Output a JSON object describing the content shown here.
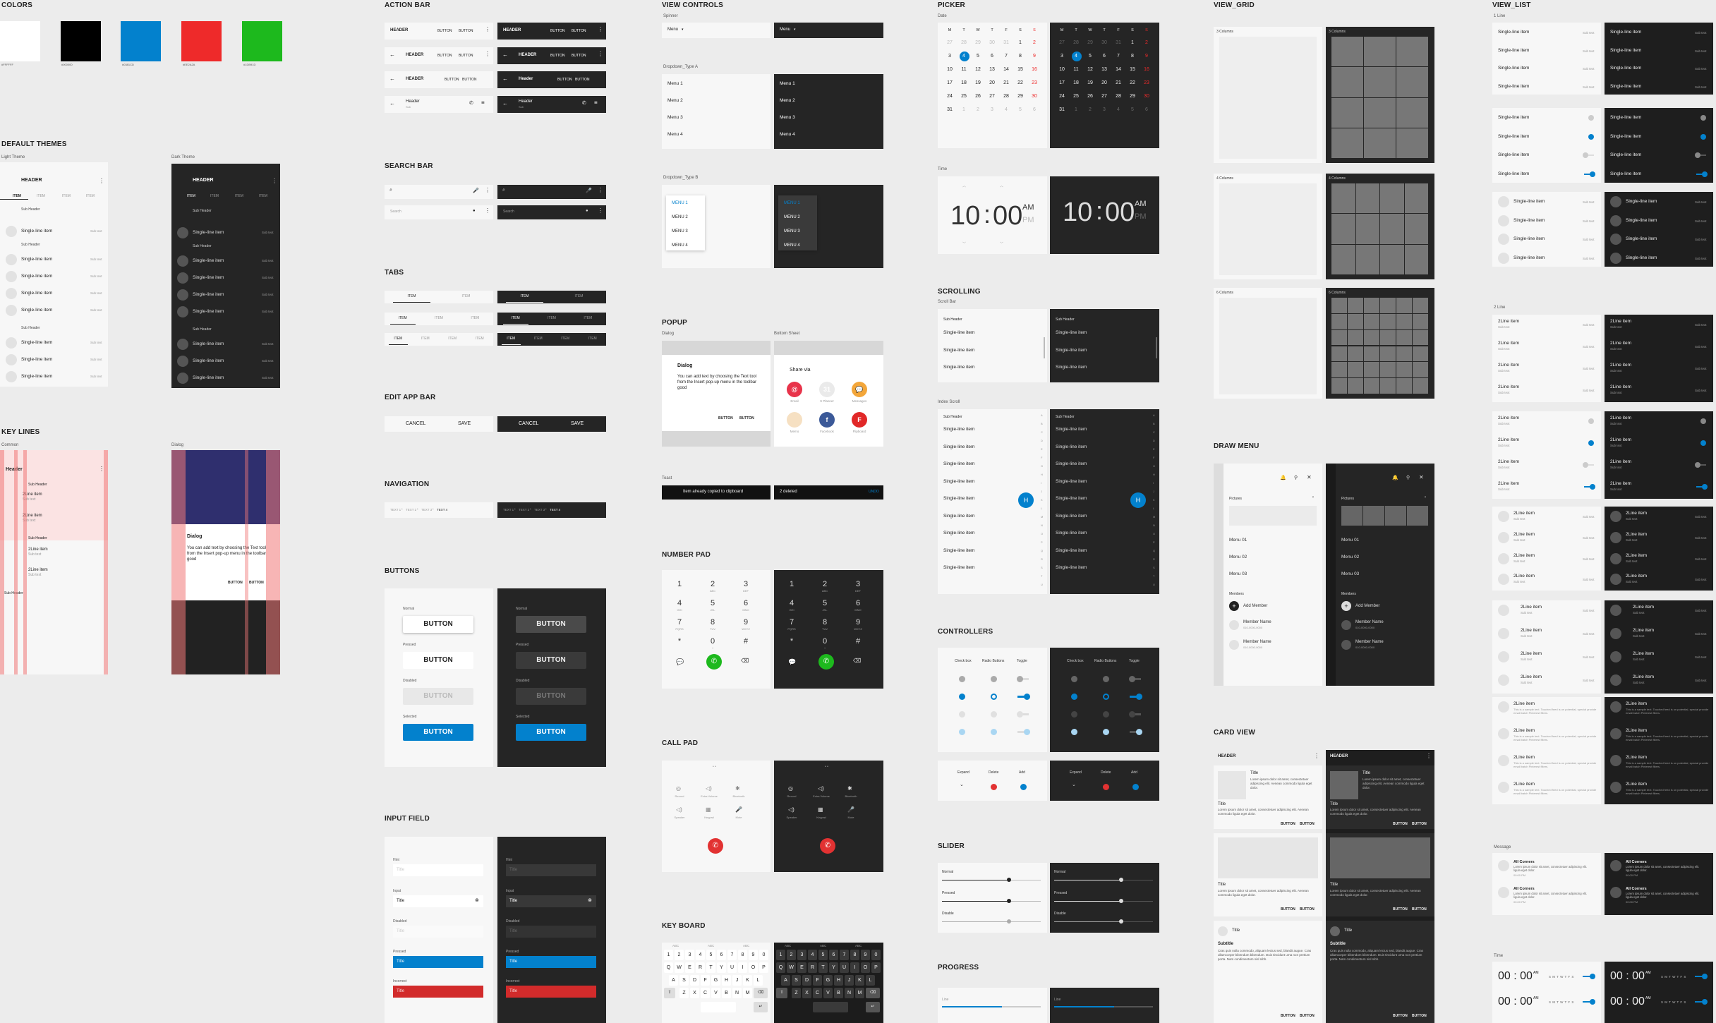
{
  "sections": {
    "colors": "COLORS",
    "default_themes": "DEFAULT THEMES",
    "key_lines": "KEY LINES",
    "action_bar": "ACTION BAR",
    "search_bar": "SEARCH BAR",
    "tabs": "TABS",
    "edit_app_bar": "EDIT APP BAR",
    "navigation": "NAVIGATION",
    "buttons": "BUTTONS",
    "input_field": "INPUT FIELD",
    "view_controls": "VIEW CONTROLS",
    "popup": "POPUP",
    "number_pad": "NUMBER PAD",
    "call_pad": "CALL PAD",
    "key_board": "KEY BOARD",
    "picker": "PICKER",
    "scrolling": "SCROLLING",
    "controllers": "CONTROLLERS",
    "slider": "SLIDER",
    "progress": "PROGRESS",
    "view_grid": "VIEW_GRID",
    "draw_menu": "DRAW MENU",
    "card_view": "CARD VIEW",
    "view_list": "VIEW_LIST"
  },
  "colors": [
    {
      "hex": "#FFFFFF",
      "label": "#FFFFFF"
    },
    {
      "hex": "#000000",
      "label": "#000000"
    },
    {
      "hex": "#0381CD",
      "label": "#0381CD"
    },
    {
      "hex": "#EE2A2A",
      "label": "#EE2A2A"
    },
    {
      "hex": "#1DB91D",
      "label": "#1DB91D"
    }
  ],
  "themes": {
    "light_label": "Light Theme",
    "dark_label": "Dark Theme",
    "light_hex": "#E4E4E4",
    "dark_hex": "#E4E4E4",
    "header": "HEADER",
    "tab_active": "ITEM",
    "tab": "ITEM",
    "sub_header": "Sub Header",
    "item": "Single-line item",
    "sub_text": "Sub text"
  },
  "keylines": {
    "common": "Common",
    "dialog": "Dialog",
    "header": "Header",
    "sub_header": "Sub Header",
    "item": "2Line item",
    "sub_text": "Sub text",
    "dialog_title": "Dialog",
    "dialog_body": "You can add text by choosing the Text tool from the Insert pop-up menu in the toolbar good",
    "button": "BUTTON"
  },
  "action_bar": {
    "header": "HEADER",
    "header_title": "Header",
    "button": "BUTTON",
    "sub_text": "Sub"
  },
  "search_bar": {
    "placeholder": "Search"
  },
  "tabs": {
    "item": "ITEM"
  },
  "edit_bar": {
    "cancel": "CANCEL",
    "save": "SAVE"
  },
  "navigation": {
    "items": [
      "TEXT 1",
      "TEXT 2",
      "TEXT 3",
      "TEXT 4"
    ]
  },
  "buttons": {
    "normal": "Normal",
    "pressed": "Pressed",
    "disabled": "Disabled",
    "selected": "Selected",
    "label": "BUTTON"
  },
  "inputs": {
    "hint": "Hint",
    "input": "Input",
    "disabled": "Disabled",
    "pressed": "Pressed",
    "incorrect": "Incorrect",
    "title": "Title"
  },
  "view_controls": {
    "spinner": "Spinner",
    "menu": "Menu",
    "dropdown_a": "Dropdown_Type A",
    "dropdown_b": "Dropdown_Type B",
    "items": [
      "Menu 1",
      "Menu 2",
      "Menu 3",
      "Menu 4"
    ],
    "items_b": [
      "MENU 1",
      "MENU 2",
      "MENU 3",
      "MENU 4"
    ]
  },
  "popup": {
    "dialog": "Dialog",
    "bottom_sheet": "Bottom Sheet",
    "dialog_title": "Dialog",
    "dialog_body": "You can add text by choosing the Text tool from the Insert pop-up menu in the toolbar good",
    "button": "BUTTON",
    "share_via": "Share via",
    "share": [
      "Email",
      "S Planner",
      "Messages",
      "Memo",
      "Facebook",
      "Flipboard"
    ],
    "toast": "Toast",
    "toast_text": "Item already copied to clipboard",
    "snackbar_text": "2 deleted",
    "snackbar_action": "UNDO"
  },
  "numpad": {
    "keys": [
      "1",
      "2",
      "3",
      "4",
      "5",
      "6",
      "7",
      "8",
      "9",
      "*",
      "0",
      "#"
    ],
    "subs": [
      "",
      "ABC",
      "DEF",
      "GHI",
      "JKL",
      "MNO",
      "PQRS",
      "TUV",
      "WXYZ",
      "",
      "+",
      ""
    ]
  },
  "callpad": {
    "labels": [
      "Record",
      "Extra Volume",
      "Bluetooth",
      "Speaker",
      "Keypad",
      "Mute"
    ]
  },
  "keyboard": {
    "row1": [
      "1",
      "2",
      "3",
      "4",
      "5",
      "6",
      "7",
      "8",
      "9",
      "0"
    ],
    "row2": [
      "Q",
      "W",
      "E",
      "R",
      "T",
      "Y",
      "U",
      "I",
      "O",
      "P"
    ],
    "row3": [
      "A",
      "S",
      "D",
      "F",
      "G",
      "H",
      "J",
      "K",
      "L"
    ],
    "row4": [
      "Z",
      "X",
      "C",
      "V",
      "B",
      "N",
      "M"
    ],
    "lang": "ABC"
  },
  "picker": {
    "date": "Date",
    "time": "Time",
    "days": [
      "M",
      "T",
      "W",
      "T",
      "F",
      "S",
      "S"
    ],
    "weeks": [
      [
        "27",
        "28",
        "29",
        "30",
        "31",
        "1",
        "2"
      ],
      [
        "3",
        "4",
        "5",
        "6",
        "7",
        "8",
        "9"
      ],
      [
        "10",
        "11",
        "12",
        "13",
        "14",
        "15",
        "16"
      ],
      [
        "17",
        "18",
        "19",
        "20",
        "21",
        "22",
        "23"
      ],
      [
        "24",
        "25",
        "26",
        "27",
        "28",
        "29",
        "30"
      ],
      [
        "31",
        "1",
        "2",
        "3",
        "4",
        "5",
        "6"
      ]
    ],
    "hour": "10",
    "sep": ":",
    "minute": "00",
    "am": "AM",
    "pm": "PM"
  },
  "scrolling": {
    "scroll_bar": "Scroll Bar",
    "index_scroll": "Index Scroll",
    "sub_header": "Sub Header",
    "item": "Single-line item",
    "index_letter": "H",
    "index": [
      "A",
      "B",
      "C",
      "D",
      "E",
      "F",
      "G",
      "H",
      "I",
      "J",
      "K",
      "L",
      "M",
      "N",
      "O",
      "P",
      "Q",
      "R",
      "S",
      "T",
      "U"
    ]
  },
  "controllers": {
    "checkbox": "Check box",
    "radio": "Radio Buttons",
    "toggle": "Toggle",
    "expand": "Expand",
    "delete": "Delete",
    "add": "Add"
  },
  "slider": {
    "normal": "Normal",
    "pressed": "Pressed",
    "disable": "Disable"
  },
  "progress": {
    "label": "Line"
  },
  "view_grid": {
    "cols3": "3 Columns",
    "cols4": "4 Columns",
    "cols6": "6 Columns"
  },
  "draw_menu": {
    "pictures": "Pictures",
    "menus": [
      "Menu 01",
      "Menu 02",
      "Menu 03"
    ],
    "members": "Members",
    "add_member": "Add Member",
    "member_name": "Member Name",
    "member_phone": "010-0000-0000"
  },
  "card_view": {
    "header": "HEADER",
    "title": "Title",
    "subtitle": "Subtitle",
    "body": "Lorem ipsum dolor sit amet, consectetuer adipiscing elit. Aenean commodo ligula eget dolor.",
    "body_long": "Cras quis nulla commodo, aliquam lectus sed, blandit augue. Cras ullamcorper bibendum bibendum. Duis tincidunt urna non pretium porta. Nam condimentum nisl nibh.",
    "button": "BUTTON"
  },
  "view_list": {
    "one_line": "1 Line",
    "two_line": "2 Line",
    "message": "Message",
    "time": "Time",
    "single": "Single-line item",
    "sub_text": "Sub text",
    "two": "2Line item",
    "sub": "Sub text",
    "msg_title": "All Corners",
    "msg_body": "Lorem ipsum dolor sit amet, consectetuer adipiscing elit. ligula eget dolor.",
    "msg_time": "00:00 PM",
    "long_text": "This is a sample text. Touched feed is on potential, special provide email batch Pinterest filters.",
    "time_value": "00 : 00",
    "time_am": "AM",
    "days": "S M T W T F S"
  }
}
